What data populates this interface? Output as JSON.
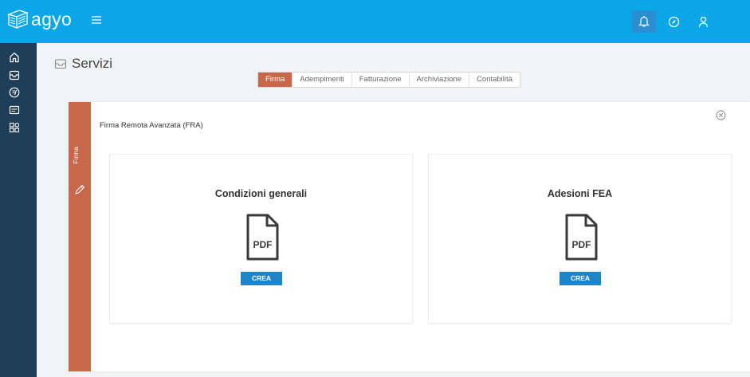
{
  "app": {
    "name": "agyo"
  },
  "colors": {
    "topbar": "#0aa6e8",
    "sidebar": "#1f3e57",
    "accent": "#c9674a",
    "button": "#1e86c8"
  },
  "topbar": {
    "icons": [
      "notification-icon",
      "compass-icon",
      "user-icon"
    ]
  },
  "sidebar": {
    "items": [
      {
        "icon": "home-icon"
      },
      {
        "icon": "inbox-icon"
      },
      {
        "icon": "finance-icon"
      },
      {
        "icon": "invoice-icon"
      },
      {
        "icon": "apps-icon"
      }
    ]
  },
  "page": {
    "title": "Servizi"
  },
  "tabs": [
    {
      "label": "Firma",
      "active": true
    },
    {
      "label": "Adempimenti",
      "active": false
    },
    {
      "label": "Fatturazione",
      "active": false
    },
    {
      "label": "Archiviazione",
      "active": false
    },
    {
      "label": "Contabilità",
      "active": false
    }
  ],
  "card": {
    "strip_label": "Firma",
    "title": "Firma Remota Avanzata (FRA)",
    "panels": [
      {
        "title": "Condizioni generali",
        "icon_text": "PDF",
        "button": "CREA"
      },
      {
        "title": "Adesioni FEA",
        "icon_text": "PDF",
        "button": "CREA"
      }
    ]
  }
}
